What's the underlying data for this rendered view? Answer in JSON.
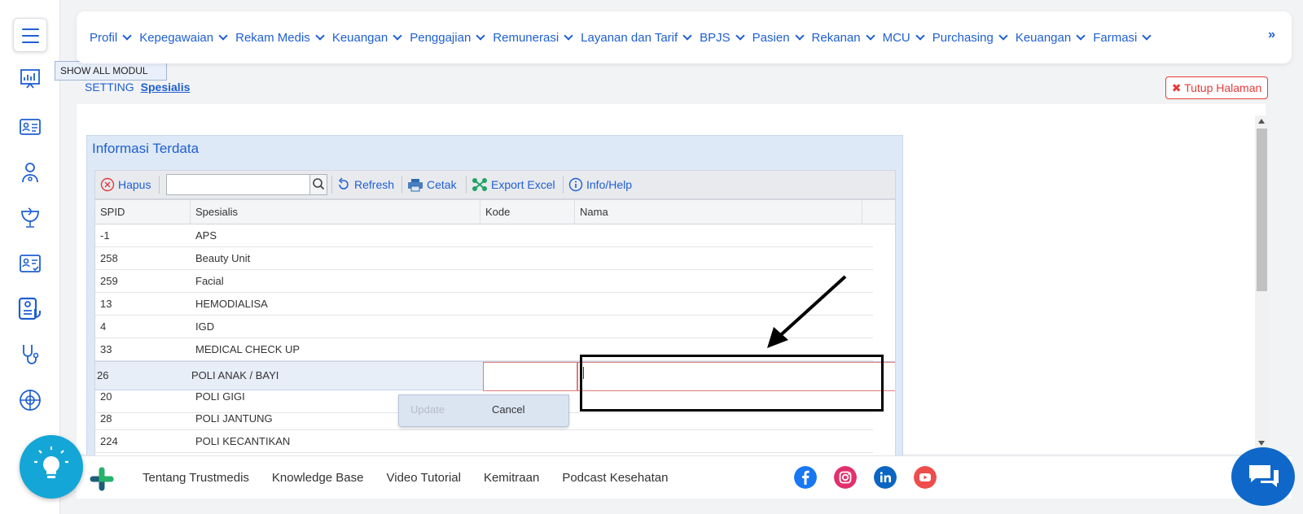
{
  "tooltip": "SHOW ALL MODUL",
  "nav": {
    "items": [
      "Profil",
      "Kepegawaian",
      "Rekam Medis",
      "Keuangan",
      "Penggajian",
      "Remunerasi",
      "Layanan dan Tarif",
      "BPJS",
      "Pasien",
      "Rekanan",
      "MCU",
      "Purchasing",
      "Keuangan",
      "Farmasi"
    ],
    "more": "»"
  },
  "breadcrumb": {
    "parent": "SETTING",
    "current": "Spesialis"
  },
  "close_page": "✖ Tutup Halaman",
  "panel": {
    "title": "Informasi Terdata"
  },
  "toolbar": {
    "delete": "Hapus",
    "search_value": "",
    "refresh": "Refresh",
    "print": "Cetak",
    "export": "Export Excel",
    "info": "Info/Help"
  },
  "grid": {
    "columns": [
      "SPID",
      "Spesialis",
      "Kode",
      "Nama"
    ],
    "rows_top": [
      {
        "spid": "-1",
        "spesialis": "APS"
      },
      {
        "spid": "258",
        "spesialis": "Beauty Unit"
      },
      {
        "spid": "259",
        "spesialis": "Facial"
      },
      {
        "spid": "13",
        "spesialis": "HEMODIALISA"
      },
      {
        "spid": "4",
        "spesialis": "IGD"
      },
      {
        "spid": "33",
        "spesialis": "MEDICAL CHECK UP"
      }
    ],
    "edit_row": {
      "spid": "26",
      "spesialis": "POLI ANAK / BAYI",
      "kode": "",
      "nama": ""
    },
    "rows_bottom": [
      {
        "spid": "20",
        "spesialis": "POLI GIGI"
      },
      {
        "spid": "28",
        "spesialis": "POLI JANTUNG"
      },
      {
        "spid": "224",
        "spesialis": "POLI KECANTIKAN"
      }
    ]
  },
  "row_editor": {
    "update": "Update",
    "cancel": "Cancel"
  },
  "footer": {
    "links": [
      "Tentang Trustmedis",
      "Knowledge Base",
      "Video Tutorial",
      "Kemitraan",
      "Podcast Kesehatan"
    ]
  },
  "colors": {
    "accent": "#1f5fd1",
    "danger": "#e53b3b",
    "bulb": "#14a6d6",
    "chat": "#0f68c9"
  }
}
